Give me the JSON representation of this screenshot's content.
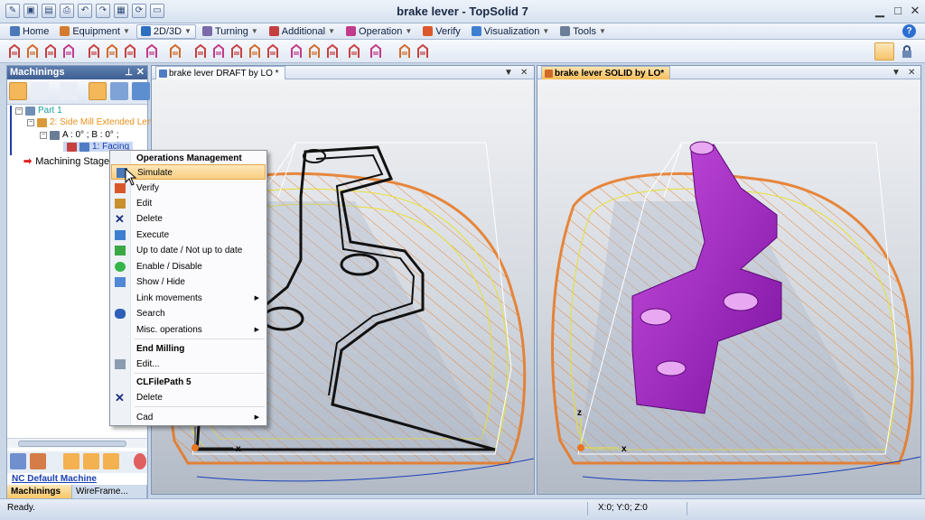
{
  "window": {
    "title": "brake  lever  - TopSolid 7"
  },
  "menu": {
    "tabs": [
      {
        "label": "Home",
        "icon": "home-icon",
        "active": false
      },
      {
        "label": "Equipment",
        "icon": "equipment-icon",
        "active": false
      },
      {
        "label": "2D/3D",
        "icon": "2d3d-icon",
        "active": true
      },
      {
        "label": "Turning",
        "icon": "turning-icon",
        "active": false
      },
      {
        "label": "Additional",
        "icon": "additional-icon",
        "active": false
      },
      {
        "label": "Operation",
        "icon": "operation-icon",
        "active": false
      },
      {
        "label": "Verify",
        "icon": "verify-icon",
        "active": false
      },
      {
        "label": "Visualization",
        "icon": "visualization-icon",
        "active": false
      },
      {
        "label": "Tools",
        "icon": "tools-icon",
        "active": false
      }
    ]
  },
  "panel": {
    "title": "Machinings",
    "tree": {
      "part": "Part 1",
      "op": "2: Side Mill Extended Len",
      "axis": "A : 0° ; B : 0° ;",
      "facing": "1: Facing",
      "stage": "Machining Stage"
    },
    "machine": "NC Default Machine",
    "tabs": {
      "machinings": "Machinings",
      "wireframe": "WireFrame..."
    }
  },
  "views": {
    "left": {
      "title": "brake  lever DRAFT by LO *"
    },
    "right": {
      "title": "brake lever SOLID by LO*"
    }
  },
  "axes": {
    "x": "x",
    "z": "z"
  },
  "context_menu": {
    "header1": "Operations Management",
    "simulate": "Simulate",
    "verify": "Verify",
    "edit": "Edit",
    "delete": "Delete",
    "execute": "Execute",
    "uptodate": "Up to date / Not up to date",
    "enable": "Enable / Disable",
    "showhide": "Show / Hide",
    "link": "Link movements",
    "search": "Search",
    "misc": "Misc. operations",
    "header2": "End Milling",
    "edit2": "Edit...",
    "header3": "CLFilePath 5",
    "delete2": "Delete",
    "cad": "Cad"
  },
  "status": {
    "text": "Ready.",
    "coords": "X:0; Y:0; Z:0"
  },
  "colors": {
    "accent": "#f7c766",
    "part_solid": "#a21fc3",
    "toolpath": "#e8761e",
    "yellow_path": "#e8e030",
    "draft": "#111111"
  }
}
